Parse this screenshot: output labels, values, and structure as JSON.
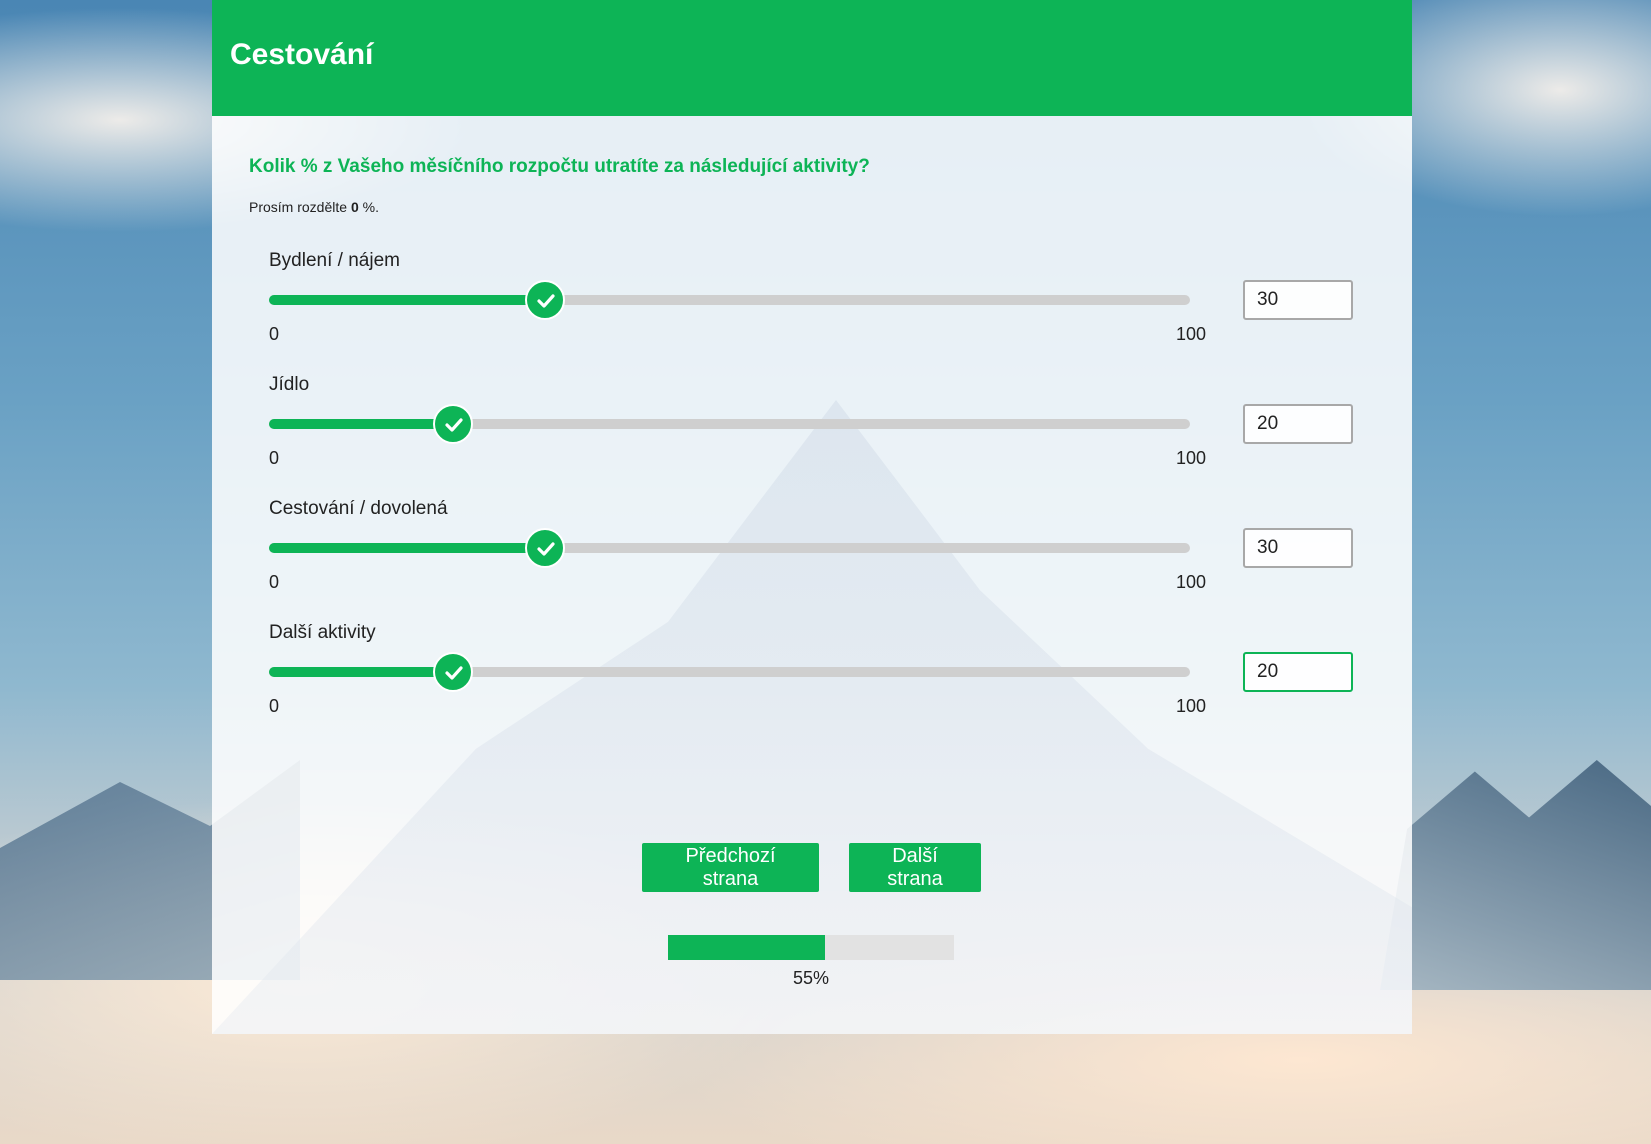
{
  "survey": {
    "title": "Cestování",
    "question": "Kolik % z Vašeho měsíčního rozpočtu utratíte za následující aktivity?",
    "hint_prefix": "Prosím rozdělte",
    "hint_value": "0",
    "hint_suffix": "%."
  },
  "colors": {
    "accent": "#0db456",
    "track": "#cfcfcf",
    "progress_bg": "#e2e2e2"
  },
  "sliders": [
    {
      "label": "Bydlení / nájem",
      "value": "30",
      "min": "0",
      "max": "100"
    },
    {
      "label": "Jídlo",
      "value": "20",
      "min": "0",
      "max": "100"
    },
    {
      "label": "Cestování / dovolená",
      "value": "30",
      "min": "0",
      "max": "100"
    },
    {
      "label": "Další aktivity",
      "value": "20",
      "min": "0",
      "max": "100"
    }
  ],
  "thumb_icon": "check-icon",
  "nav": {
    "prev_label": "Předchozí strana",
    "next_label": "Další strana"
  },
  "progress": {
    "value": 55,
    "text": "55%"
  }
}
